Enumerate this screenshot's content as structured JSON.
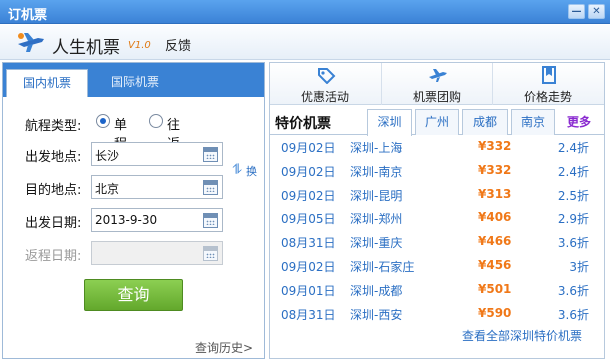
{
  "window": {
    "title": "订机票",
    "minimize_glyph": "—",
    "close_glyph": "✕"
  },
  "header": {
    "app_name": "人生机票",
    "version": "V1.0",
    "feedback": "反馈",
    "logo_icon": "plane-logo-icon"
  },
  "left": {
    "tabs": [
      {
        "label": "国内机票",
        "active": true
      },
      {
        "label": "国际机票",
        "active": false
      }
    ],
    "trip_type_label": "航程类型:",
    "trip_types": [
      {
        "label": "单程",
        "checked": true
      },
      {
        "label": "往返",
        "checked": false
      }
    ],
    "from_label": "出发地点:",
    "from_value": "长沙",
    "to_label": "目的地点:",
    "to_value": "北京",
    "depart_label": "出发日期:",
    "depart_value": "2013-9-30",
    "return_label": "返程日期:",
    "return_value": "",
    "swap_label": "换",
    "search_label": "查询",
    "history_label": "查询历史>"
  },
  "right": {
    "tools": [
      {
        "label": "优惠活动",
        "icon": "tag-icon"
      },
      {
        "label": "机票团购",
        "icon": "airplane-icon"
      },
      {
        "label": "价格走势",
        "icon": "bookmark-icon"
      }
    ],
    "section_title": "特价机票",
    "city_tabs": [
      {
        "label": "深圳",
        "active": true
      },
      {
        "label": "广州",
        "active": false
      },
      {
        "label": "成都",
        "active": false
      },
      {
        "label": "南京",
        "active": false
      }
    ],
    "more_label": "更多",
    "deals": [
      {
        "date": "09月02日",
        "route": "深圳-上海",
        "price": "¥332",
        "discount": "2.4折"
      },
      {
        "date": "09月02日",
        "route": "深圳-南京",
        "price": "¥332",
        "discount": "2.4折"
      },
      {
        "date": "09月02日",
        "route": "深圳-昆明",
        "price": "¥313",
        "discount": "2.5折"
      },
      {
        "date": "09月05日",
        "route": "深圳-郑州",
        "price": "¥406",
        "discount": "2.9折"
      },
      {
        "date": "08月31日",
        "route": "深圳-重庆",
        "price": "¥466",
        "discount": "3.6折"
      },
      {
        "date": "09月02日",
        "route": "深圳-石家庄",
        "price": "¥456",
        "discount": "3折"
      },
      {
        "date": "09月01日",
        "route": "深圳-成都",
        "price": "¥501",
        "discount": "3.6折"
      },
      {
        "date": "08月31日",
        "route": "深圳-西安",
        "price": "¥590",
        "discount": "3.6折"
      }
    ],
    "view_all_label": "查看全部深圳特价机票"
  },
  "colors": {
    "accent": "#3a82d4",
    "price": "#f07818",
    "link": "#2b6fc3",
    "search_button": "#6db434",
    "more": "#8a2ad0"
  }
}
